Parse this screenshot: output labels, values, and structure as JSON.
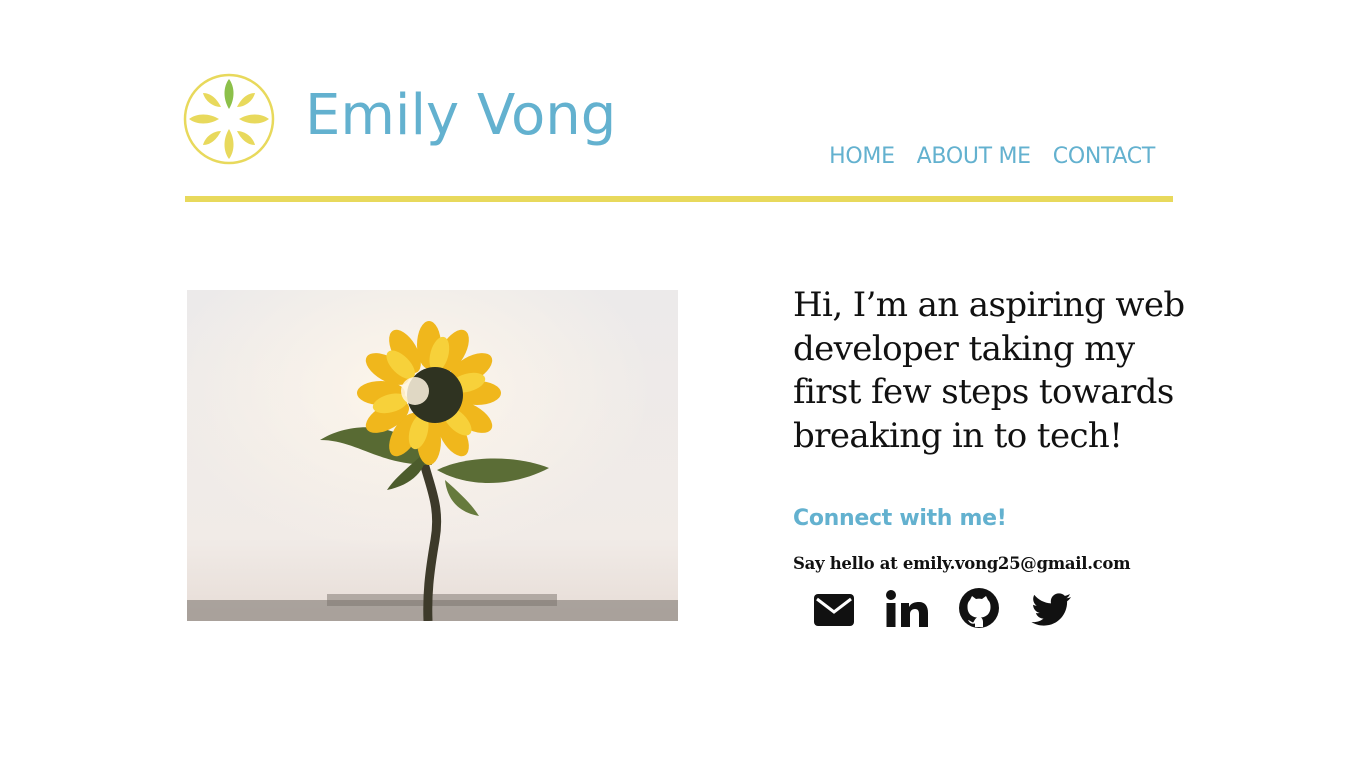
{
  "header": {
    "site_title": "Emily Vong",
    "nav": [
      {
        "label": "HOME"
      },
      {
        "label": "ABOUT ME"
      },
      {
        "label": "CONTACT"
      }
    ],
    "logo_icon": "sunflower-logo-icon"
  },
  "main": {
    "hero_image_icon": "sunflower-photo",
    "intro": "Hi, I’m an aspiring web developer taking my first few steps towards breaking in to tech!",
    "connect_heading": "Connect with me!",
    "hello_line": "Say hello at emily.vong25@gmail.com",
    "socials": [
      {
        "icon": "envelope-icon"
      },
      {
        "icon": "linkedin-icon"
      },
      {
        "icon": "github-icon"
      },
      {
        "icon": "twitter-icon"
      }
    ]
  },
  "colors": {
    "accent_blue": "#63b1cf",
    "accent_yellow": "#e8d95c",
    "leaf_green": "#8cc04a",
    "text": "#111111"
  }
}
